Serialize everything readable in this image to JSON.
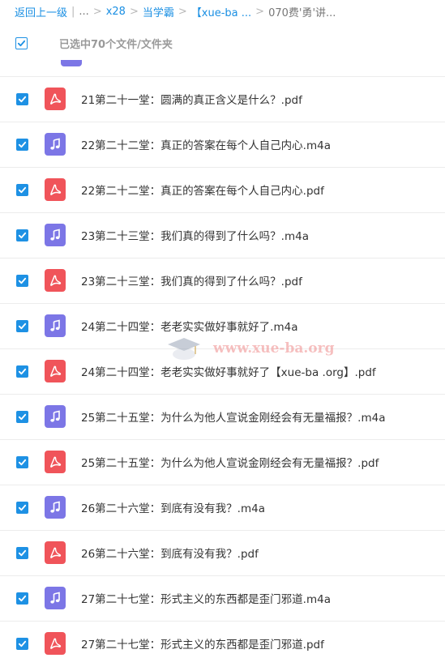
{
  "breadcrumb": {
    "back": "返回上一级",
    "divider": "|",
    "ellipsis": "...",
    "items": [
      "x28",
      "当学霸",
      "【xue-ba ...",
      "070费'勇'讲..."
    ],
    "separator": ">"
  },
  "selection": {
    "label": "已选中70个文件/文件夹"
  },
  "watermark": {
    "text": "www.xue-ba.org"
  },
  "colors": {
    "accent": "#1e91e4",
    "pdf": "#f0545a",
    "m4a": "#7c76e6"
  },
  "files": [
    {
      "name": "21第二十一堂：圆满的真正含义是什么？.pdf",
      "type": "pdf",
      "icon": "pdf-icon",
      "checked": true
    },
    {
      "name": "22第二十二堂：真正的答案在每个人自己内心.m4a",
      "type": "m4a",
      "icon": "music-note-icon",
      "checked": true
    },
    {
      "name": "22第二十二堂：真正的答案在每个人自己内心.pdf",
      "type": "pdf",
      "icon": "pdf-icon",
      "checked": true
    },
    {
      "name": "23第二十三堂：我们真的得到了什么吗？.m4a",
      "type": "m4a",
      "icon": "music-note-icon",
      "checked": true
    },
    {
      "name": "23第二十三堂：我们真的得到了什么吗？.pdf",
      "type": "pdf",
      "icon": "pdf-icon",
      "checked": true
    },
    {
      "name": "24第二十四堂：老老实实做好事就好了.m4a",
      "type": "m4a",
      "icon": "music-note-icon",
      "checked": true
    },
    {
      "name": "24第二十四堂：老老实实做好事就好了【xue-ba .org】.pdf",
      "type": "pdf",
      "icon": "pdf-icon",
      "checked": true
    },
    {
      "name": "25第二十五堂：为什么为他人宣说金刚经会有无量福报？.m4a",
      "type": "m4a",
      "icon": "music-note-icon",
      "checked": true
    },
    {
      "name": "25第二十五堂：为什么为他人宣说金刚经会有无量福报？.pdf",
      "type": "pdf",
      "icon": "pdf-icon",
      "checked": true
    },
    {
      "name": "26第二十六堂：到底有没有我？.m4a",
      "type": "m4a",
      "icon": "music-note-icon",
      "checked": true
    },
    {
      "name": "26第二十六堂：到底有没有我？.pdf",
      "type": "pdf",
      "icon": "pdf-icon",
      "checked": true
    },
    {
      "name": "27第二十七堂：形式主义的东西都是歪门邪道.m4a",
      "type": "m4a",
      "icon": "music-note-icon",
      "checked": true
    },
    {
      "name": "27第二十七堂：形式主义的东西都是歪门邪道.pdf",
      "type": "pdf",
      "icon": "pdf-icon",
      "checked": true
    }
  ]
}
